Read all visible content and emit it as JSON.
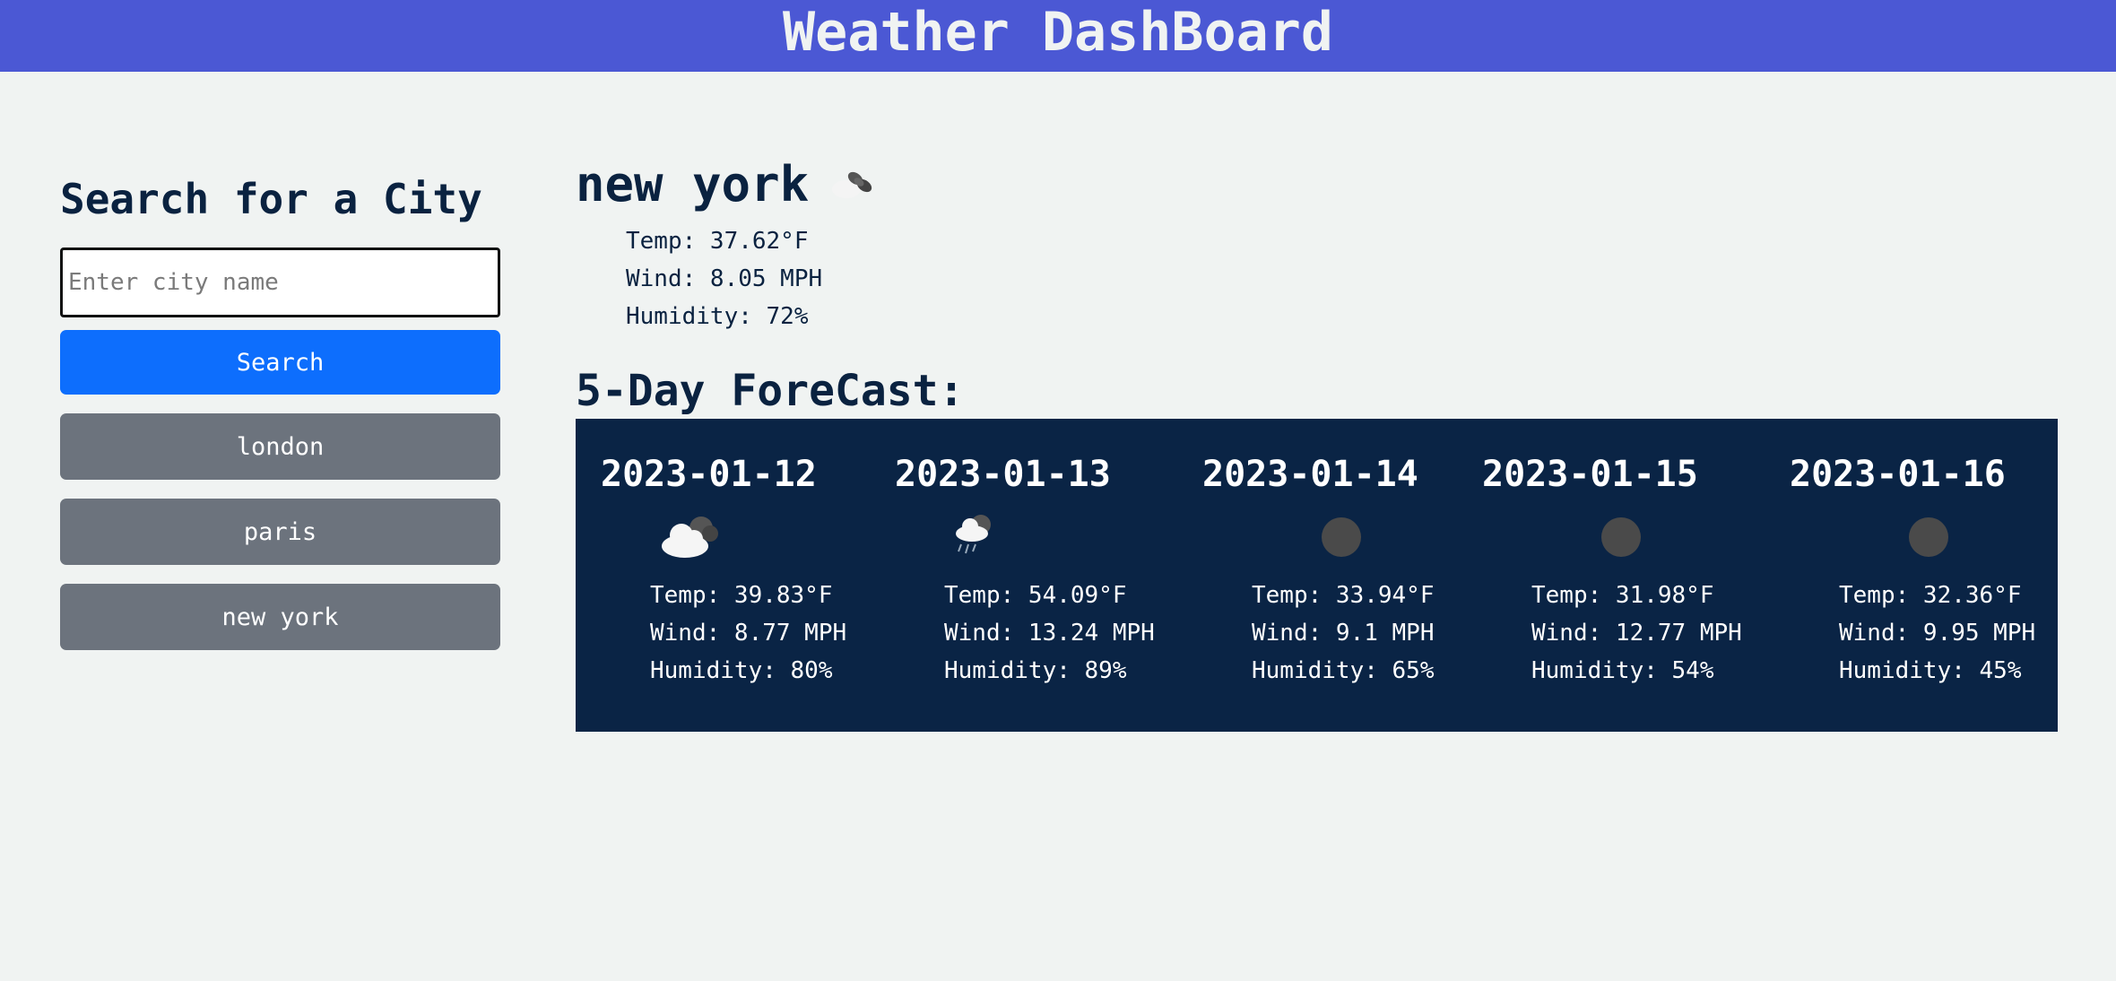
{
  "header": {
    "title": "Weather DashBoard"
  },
  "search": {
    "heading": "Search for a City",
    "placeholder": "Enter city name",
    "button_label": "Search"
  },
  "history": [
    {
      "label": "london"
    },
    {
      "label": "paris"
    },
    {
      "label": "new york"
    }
  ],
  "current": {
    "city": "new york",
    "icon": "broken-clouds-icon",
    "temp": "Temp: 37.62°F",
    "wind": "Wind: 8.05 MPH",
    "humidity": "Humidity: 72%"
  },
  "forecast": {
    "title": "5-Day ForeCast:",
    "days": [
      {
        "date": "2023-01-12",
        "icon": "broken-clouds-icon",
        "temp": "Temp: 39.83°F",
        "wind": "Wind: 8.77 MPH",
        "humidity": "Humidity: 80%"
      },
      {
        "date": "2023-01-13",
        "icon": "rain-icon",
        "temp": "Temp: 54.09°F",
        "wind": "Wind: 13.24 MPH",
        "humidity": "Humidity: 89%"
      },
      {
        "date": "2023-01-14",
        "icon": "clear-night-icon",
        "temp": "Temp: 33.94°F",
        "wind": "Wind: 9.1 MPH",
        "humidity": "Humidity: 65%"
      },
      {
        "date": "2023-01-15",
        "icon": "clear-night-icon",
        "temp": "Temp: 31.98°F",
        "wind": "Wind: 12.77 MPH",
        "humidity": "Humidity: 54%"
      },
      {
        "date": "2023-01-16",
        "icon": "clear-night-icon",
        "temp": "Temp: 32.36°F",
        "wind": "Wind: 9.95 MPH",
        "humidity": "Humidity: 45%"
      }
    ]
  },
  "colors": {
    "header_bg": "#4b58d4",
    "page_bg": "#f0f3f2",
    "search_button": "#0d6efd",
    "history_button": "#6c737d",
    "forecast_panel": "#0a2445",
    "text_dark": "#0a2240"
  }
}
